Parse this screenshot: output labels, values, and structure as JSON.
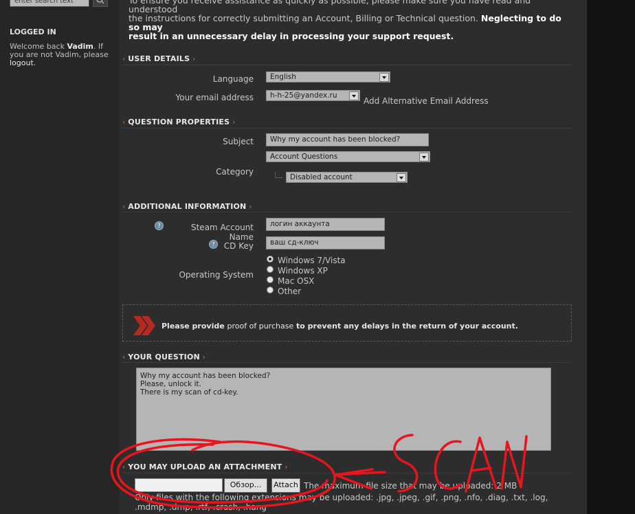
{
  "sidebar": {
    "search_placeholder": "enter search text",
    "logged_in_heading": "LOGGED IN",
    "welcome_prefix": "Welcome back ",
    "user_name": "Vadim",
    "welcome_suffix": ". If you are not Vadim, please ",
    "logout_label": "logout",
    "period": "."
  },
  "intro": {
    "line1": "To ensure you receive assistance as quickly as possible, please make sure you have read and understood",
    "line2": "the instructions for correctly submitting an Account, Billing or Technical question. ",
    "line2_bold": "Neglecting to do so may",
    "line3_bold": "result in an unnecessary delay in processing your support request."
  },
  "user_details": {
    "heading": "USER DETAILS",
    "language_label": "Language",
    "language_value": "English",
    "email_label": "Your email address",
    "email_value": "h-h-25@yandex.ru",
    "alt_email_link": "Add Alternative Email Address"
  },
  "question_properties": {
    "heading": "QUESTION PROPERTIES",
    "subject_label": "Subject",
    "subject_value": "Why my account has been blocked?",
    "category_label": "Category",
    "category_value": "Account Questions",
    "subcategory_value": "Disabled account"
  },
  "additional_info": {
    "heading": "ADDITIONAL INFORMATION",
    "steam_account_label": "Steam Account Name",
    "steam_account_value": "логин аккаунта",
    "cd_key_label": "CD Key",
    "cd_key_value": "ваш сд-ключ",
    "os_label": "Operating System",
    "os_options": [
      "Windows 7/Vista",
      "Windows XP",
      "Mac OSX",
      "Other"
    ],
    "os_selected": "Windows 7/Vista"
  },
  "notice": {
    "text_a": "Please provide ",
    "text_b": "proof of purchase",
    "text_c": " to prevent any delays in the return of your account."
  },
  "your_question": {
    "heading": "YOUR QUESTION",
    "lines": [
      "Why my account has been blocked?",
      "Please, unlock it.",
      "There is my scan of cd-key."
    ]
  },
  "attachment": {
    "heading": "YOU MAY UPLOAD AN ATTACHMENT",
    "browse_label": "Обзор...",
    "attach_label": "Attach",
    "max_size_text": "The maximum file size that may be uploaded: 2 MB",
    "extensions_text": "Only files with the following extensions may be uploaded: .jpg, .jpeg, .gif, .png, .nfo, .diag, .txt, .log,",
    "extensions_text2": ".mdmp, .dmp, .rtf, .crash, .hang"
  },
  "annotation": {
    "scribble_text": "SCAN",
    "color": "#e8141e"
  },
  "colors": {
    "accent": "#c2702f",
    "background": "#2d2d2d",
    "notice_icon": "#b52a1e"
  }
}
